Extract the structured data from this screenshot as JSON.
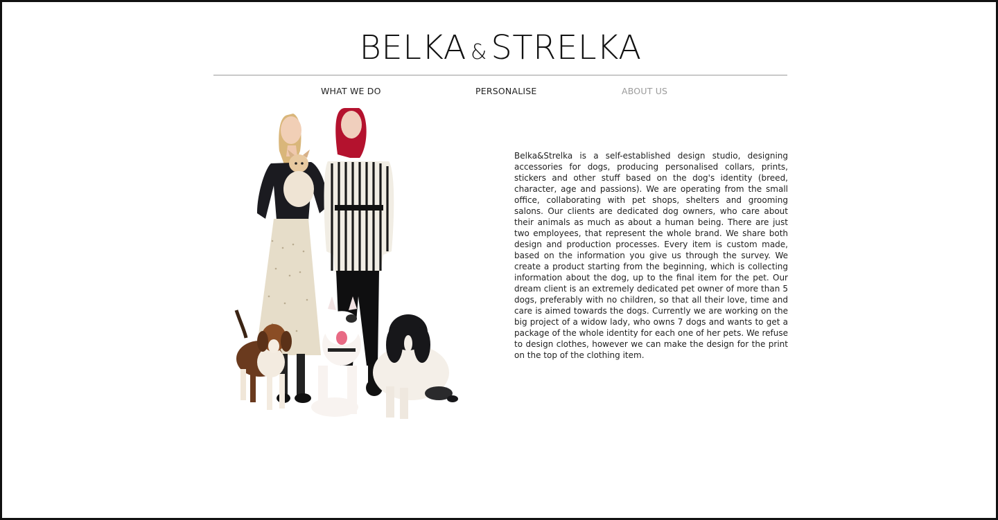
{
  "brand": {
    "logo_part1": "BELKA",
    "logo_amp": "&",
    "logo_part2": "STRELKA"
  },
  "nav": {
    "items": [
      {
        "label": "WHAT WE DO",
        "active": false
      },
      {
        "label": "PERSONALISE",
        "active": false
      },
      {
        "label": "ABOUT US",
        "active": true
      }
    ]
  },
  "about": {
    "text": "Belka&Strelka is a self-established design studio, designing accessories for dogs, producing personalised collars, prints, stickers and other stuff based on the dog's identity (breed, character, age and passions). We are operating from the small office, collaborating with pet shops, shelters and grooming salons. Our clients are dedicated dog owners, who care about their animals as much as about a human being. There are just two employees, that represent the whole brand. We share both design and production processes. Every item is custom made, based on the information you give us through the survey.  We create a product starting from the beginning, which is collecting information about the dog, up to the final item for the pet. Our dream client is an extremely dedicated pet owner of more than 5 dogs, preferably with no children, so that all their love, time and care is aimed towards the dogs. Currently we are working on the big project of a widow lady, who owns 7 dogs and wants to get a package of the whole identity for each one of her pets. We refuse to design clothes, however we can make the design for the print on the top of the clothing item."
  },
  "colors": {
    "nav_active": "#9b9b9b",
    "text": "#1e1e1e",
    "divider": "#9a9a9a"
  }
}
